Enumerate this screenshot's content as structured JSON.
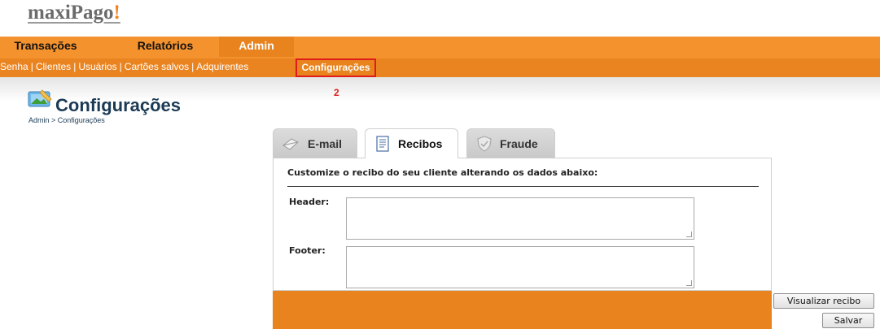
{
  "brand": {
    "name": "maxiPago",
    "exclaim": "!"
  },
  "top_nav": {
    "tabs": [
      "Transações",
      "Relatórios",
      "Admin"
    ],
    "active": "Admin"
  },
  "sub_nav": {
    "links": [
      "Senha",
      "Clientes",
      "Usuários",
      "Cartões salvos",
      "Adquirentes"
    ],
    "separator": "|",
    "current": "Configurações"
  },
  "annotation_marker": "2",
  "page": {
    "title": "Configurações",
    "breadcrumb": "Admin > Configurações"
  },
  "tabs": [
    {
      "label": "E-mail",
      "icon": "envelope-icon",
      "active": false
    },
    {
      "label": "Recibos",
      "icon": "receipt-icon",
      "active": true
    },
    {
      "label": "Fraude",
      "icon": "shield-icon",
      "active": false
    }
  ],
  "form": {
    "instructions": "Customize o recibo do seu cliente alterando os dados abaixo:",
    "header_label": "Header:",
    "header_value": "",
    "footer_label": "Footer:",
    "footer_value": ""
  },
  "buttons": {
    "preview": "Visualizar recibo",
    "save": "Salvar"
  },
  "colors": {
    "nav_orange": "#f4922e",
    "active_orange": "#e8831e",
    "highlight_red": "#e01b1b",
    "title_navy": "#1b3a55"
  }
}
